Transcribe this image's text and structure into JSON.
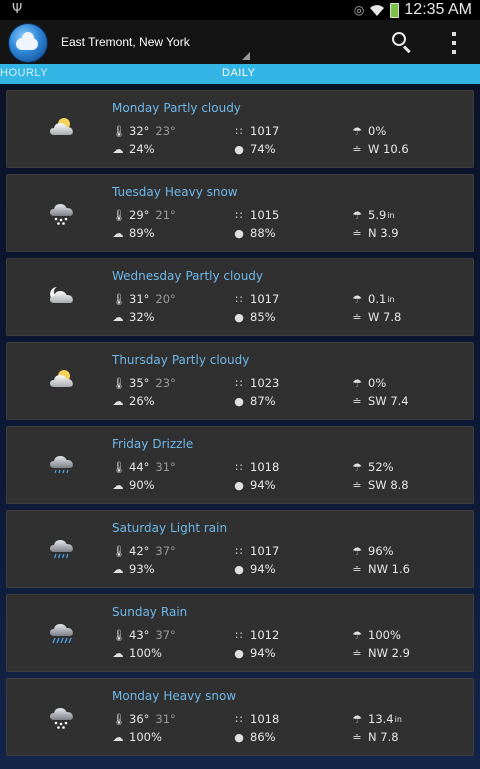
{
  "status_bar": {
    "time": "12:35 AM"
  },
  "header": {
    "location": "East Tremont, New York"
  },
  "tabs": [
    {
      "label": "HOURLY"
    },
    {
      "label": "DAILY"
    }
  ],
  "days": [
    {
      "day": "Monday",
      "condition": "Partly cloudy",
      "icon": "partly-cloudy-day-icon",
      "high": "32°",
      "low": "23°",
      "pressure": "1017",
      "precip": "0%",
      "precip_unit": "",
      "cloud": "24%",
      "humidity": "74%",
      "wind": "W 10.6"
    },
    {
      "day": "Tuesday",
      "condition": "Heavy snow",
      "icon": "heavy-snow-icon",
      "high": "29°",
      "low": "21°",
      "pressure": "1015",
      "precip": "5.9",
      "precip_unit": "in",
      "cloud": "89%",
      "humidity": "88%",
      "wind": "N 3.9"
    },
    {
      "day": "Wednesday",
      "condition": "Partly cloudy",
      "icon": "partly-cloudy-night-icon",
      "high": "31°",
      "low": "20°",
      "pressure": "1017",
      "precip": "0.1",
      "precip_unit": "in",
      "cloud": "32%",
      "humidity": "85%",
      "wind": "W 7.8"
    },
    {
      "day": "Thursday",
      "condition": "Partly cloudy",
      "icon": "partly-cloudy-day-icon",
      "high": "35°",
      "low": "23°",
      "pressure": "1023",
      "precip": "0%",
      "precip_unit": "",
      "cloud": "26%",
      "humidity": "87%",
      "wind": "SW 7.4"
    },
    {
      "day": "Friday",
      "condition": "Drizzle",
      "icon": "drizzle-icon",
      "high": "44°",
      "low": "31°",
      "pressure": "1018",
      "precip": "52%",
      "precip_unit": "",
      "cloud": "90%",
      "humidity": "94%",
      "wind": "SW 8.8"
    },
    {
      "day": "Saturday",
      "condition": "Light rain",
      "icon": "light-rain-icon",
      "high": "42°",
      "low": "37°",
      "pressure": "1017",
      "precip": "96%",
      "precip_unit": "",
      "cloud": "93%",
      "humidity": "94%",
      "wind": "NW 1.6"
    },
    {
      "day": "Sunday",
      "condition": "Rain",
      "icon": "rain-icon",
      "high": "43°",
      "low": "37°",
      "pressure": "1012",
      "precip": "100%",
      "precip_unit": "",
      "cloud": "100%",
      "humidity": "94%",
      "wind": "NW 2.9"
    },
    {
      "day": "Monday",
      "condition": "Heavy snow",
      "icon": "heavy-snow-icon",
      "high": "36°",
      "low": "31°",
      "pressure": "1018",
      "precip": "13.4",
      "precip_unit": "in",
      "cloud": "100%",
      "humidity": "86%",
      "wind": "N 7.8"
    }
  ]
}
